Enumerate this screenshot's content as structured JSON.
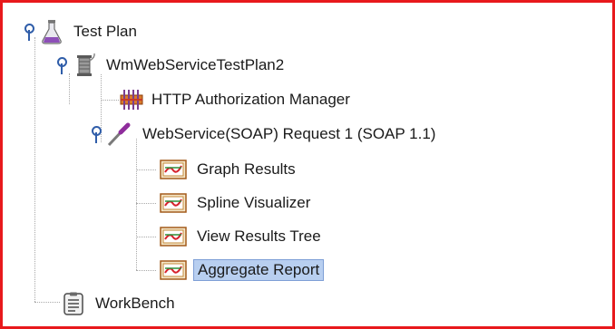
{
  "tree": {
    "test_plan": "Test Plan",
    "service_plan": "WmWebServiceTestPlan2",
    "auth_manager": "HTTP Authorization Manager",
    "soap_request": "WebService(SOAP) Request 1 (SOAP 1.1)",
    "graph_results": "Graph Results",
    "spline_visualizer": "Spline Visualizer",
    "view_results_tree": "View Results Tree",
    "aggregate_report": "Aggregate Report",
    "workbench": "WorkBench"
  },
  "colors": {
    "border": "#e8191c",
    "selection": "#b8cff0",
    "toggle": "#2f5da9"
  }
}
